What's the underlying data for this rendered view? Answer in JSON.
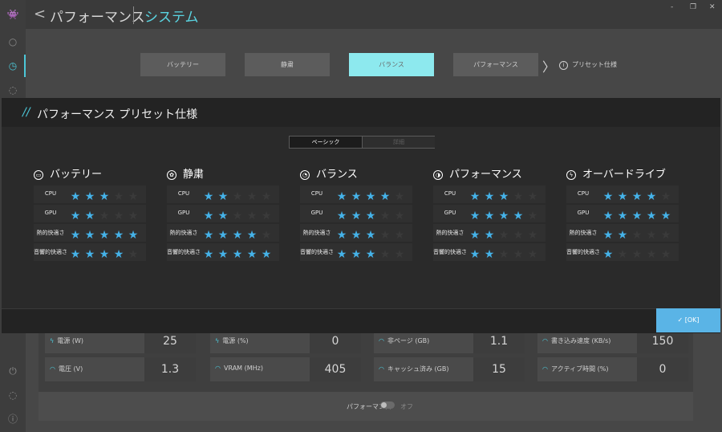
{
  "header": {
    "back_glyph": "<",
    "title": "パフォーマンス",
    "subtitle": "システム"
  },
  "window": {
    "minimize": "-",
    "maximize": "❐",
    "close": "✕"
  },
  "modes": [
    {
      "label": "バッテリー",
      "active": false
    },
    {
      "label": "静粛",
      "active": false
    },
    {
      "label": "バランス",
      "active": true
    },
    {
      "label": "パフォーマンス",
      "active": false
    }
  ],
  "preset_link": {
    "label": "プリセット仕様"
  },
  "modal": {
    "slashes": "//",
    "title": "パフォーマンス プリセット仕様",
    "segments": [
      "ベーシック",
      "詳細"
    ],
    "row_labels": [
      "CPU",
      "GPU",
      "熱的快適さ",
      "音響的快適さ"
    ],
    "presets": [
      {
        "name": "バッテリー",
        "icon": "battery-icon",
        "ratings": [
          3,
          2,
          5,
          4
        ]
      },
      {
        "name": "静粛",
        "icon": "quiet-icon",
        "ratings": [
          2,
          2,
          4,
          5
        ]
      },
      {
        "name": "バランス",
        "icon": "balance-icon",
        "ratings": [
          4,
          3,
          3,
          3
        ]
      },
      {
        "name": "パフォーマンス",
        "icon": "performance-icon",
        "ratings": [
          3,
          4,
          2,
          2
        ]
      },
      {
        "name": "オーバードライブ",
        "icon": "overdrive-icon",
        "ratings": [
          4,
          5,
          2,
          1
        ]
      }
    ],
    "max_stars": 5,
    "ok_label": "✓ [OK]"
  },
  "stats": [
    {
      "label": "電源 (W)",
      "value": "25",
      "icon": "bolt-icon"
    },
    {
      "label": "電源 (%)",
      "value": "0",
      "icon": "bolt-icon"
    },
    {
      "label": "非ページ (GB)",
      "value": "1.1",
      "icon": "gauge-icon"
    },
    {
      "label": "書き込み速度 (KB/s)",
      "value": "150",
      "icon": "gauge-icon"
    },
    {
      "label": "電圧 (V)",
      "value": "1.3",
      "icon": "gauge-icon"
    },
    {
      "label": "VRAM (MHz)",
      "value": "405",
      "icon": "gauge-icon"
    },
    {
      "label": "キャッシュ済み (GB)",
      "value": "15",
      "icon": "gauge-icon"
    },
    {
      "label": "アクティブ時間 (%)",
      "value": "0",
      "icon": "gauge-icon"
    }
  ],
  "footer": {
    "toggle_label": "パフォーマンス",
    "toggle_state": "オフ"
  },
  "colors": {
    "accent": "#4cc7d8",
    "star_on": "#45b2e8",
    "active_tab": "#8de9ee",
    "ok_button": "#5ab4e6"
  }
}
